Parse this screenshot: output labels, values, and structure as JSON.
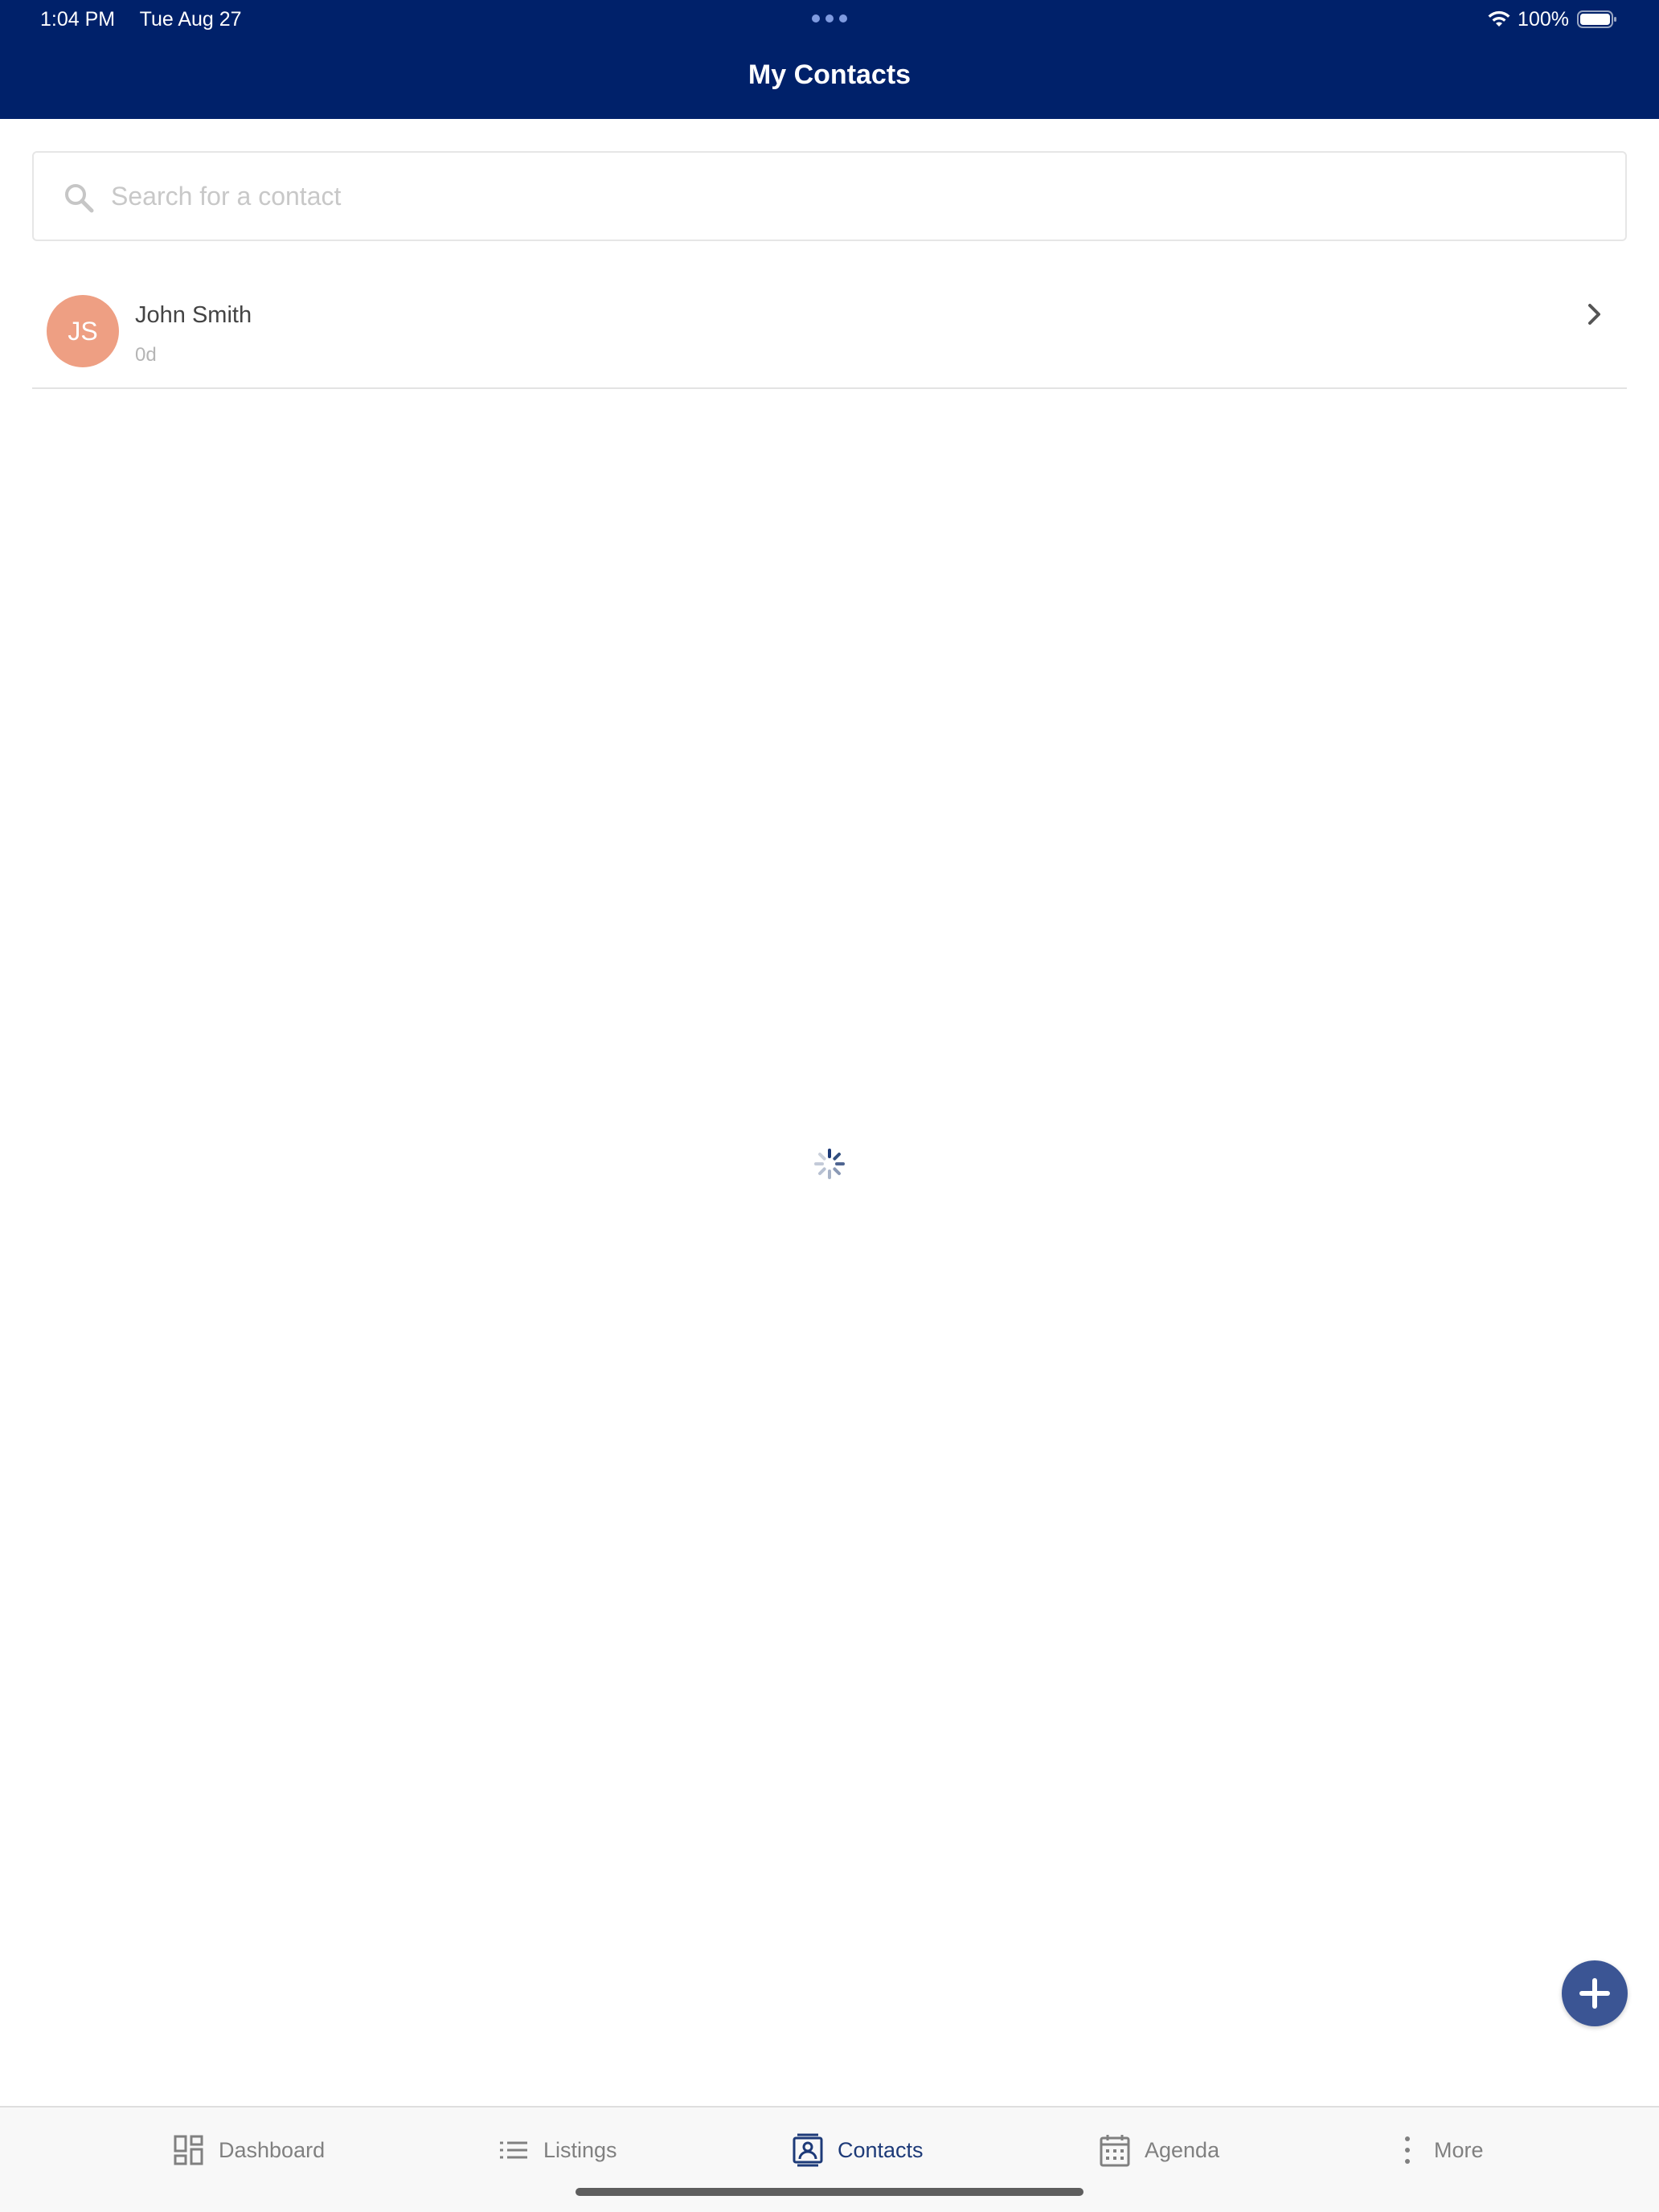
{
  "status_bar": {
    "time": "1:04 PM",
    "date": "Tue Aug 27",
    "battery": "100%"
  },
  "header": {
    "title": "My Contacts",
    "color": "#00216a"
  },
  "search": {
    "placeholder": "Search for a contact",
    "value": ""
  },
  "contacts": [
    {
      "initials": "JS",
      "name": "John Smith",
      "age": "0d",
      "avatar_color": "#ee9f83"
    }
  ],
  "fab": {
    "icon": "plus-icon",
    "color": "#3b5594"
  },
  "tabs": [
    {
      "label": "Dashboard",
      "icon": "dashboard-icon",
      "active": false
    },
    {
      "label": "Listings",
      "icon": "list-icon",
      "active": false
    },
    {
      "label": "Contacts",
      "icon": "contacts-icon",
      "active": true
    },
    {
      "label": "Agenda",
      "icon": "calendar-icon",
      "active": false
    },
    {
      "label": "More",
      "icon": "more-vertical-icon",
      "active": false
    }
  ],
  "loading": true
}
